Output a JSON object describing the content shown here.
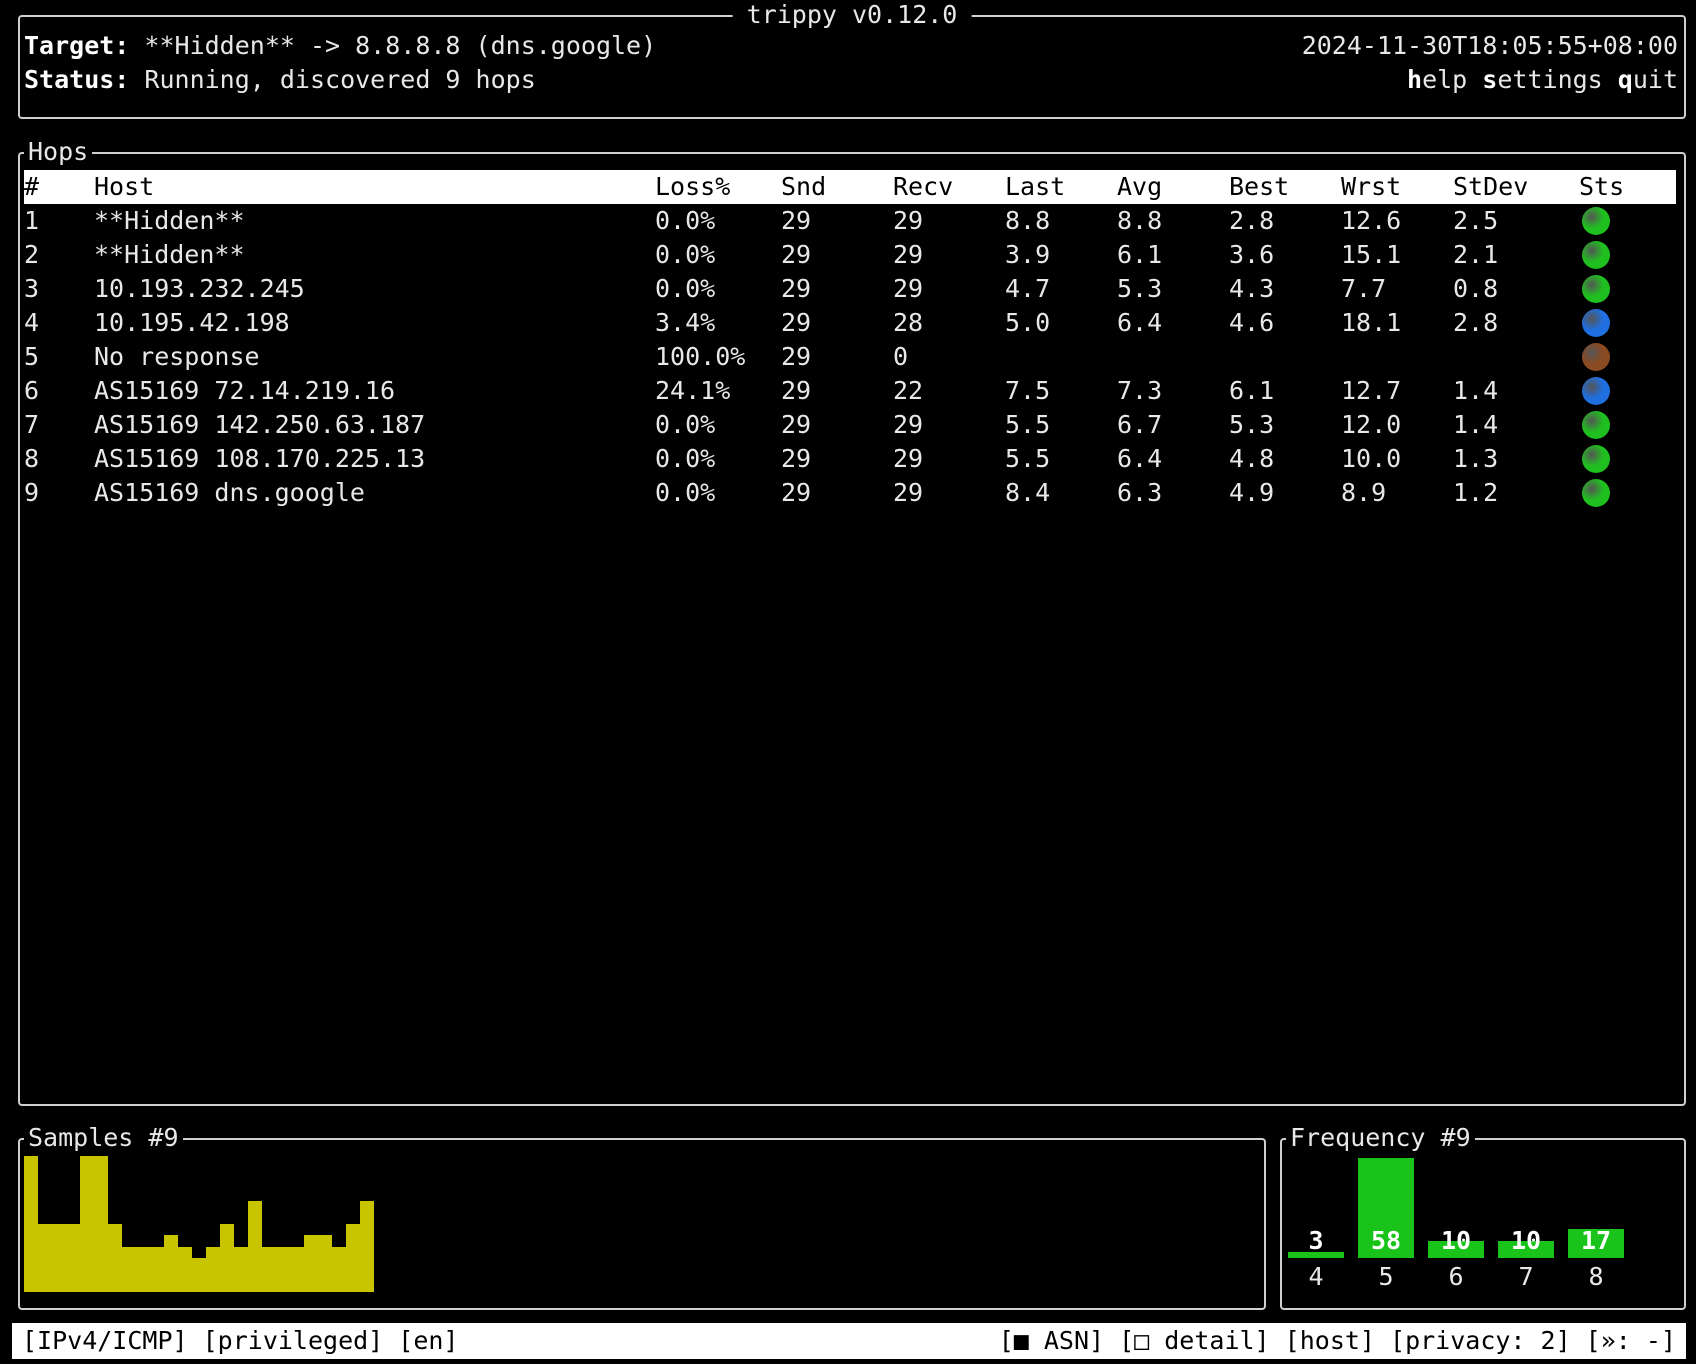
{
  "app": {
    "title": "trippy v0.12.0"
  },
  "header": {
    "target_label": "Target:",
    "target_value": " **Hidden** -> 8.8.8.8 (dns.google)",
    "status_label": "Status:",
    "status_value": " Running, discovered 9 hops",
    "timestamp": "2024-11-30T18:05:55+08:00",
    "menu": [
      {
        "key": "h",
        "rest": "elp"
      },
      {
        "key": "s",
        "rest": "ettings"
      },
      {
        "key": "q",
        "rest": "uit"
      }
    ]
  },
  "hops": {
    "title": "Hops",
    "columns": [
      "#",
      "Host",
      "Loss%",
      "Snd",
      "Recv",
      "Last",
      "Avg",
      "Best",
      "Wrst",
      "StDev",
      "Sts"
    ],
    "rows": [
      {
        "n": "1",
        "host": "**Hidden**",
        "loss": "0.0%",
        "snd": "29",
        "recv": "29",
        "last": "8.8",
        "avg": "8.8",
        "best": "2.8",
        "wrst": "12.6",
        "stdev": "2.5",
        "sts": "#1fbf1f"
      },
      {
        "n": "2",
        "host": "**Hidden**",
        "loss": "0.0%",
        "snd": "29",
        "recv": "29",
        "last": "3.9",
        "avg": "6.1",
        "best": "3.6",
        "wrst": "15.1",
        "stdev": "2.1",
        "sts": "#1fbf1f"
      },
      {
        "n": "3",
        "host": "10.193.232.245",
        "loss": "0.0%",
        "snd": "29",
        "recv": "29",
        "last": "4.7",
        "avg": "5.3",
        "best": "4.3",
        "wrst": "7.7",
        "stdev": "0.8",
        "sts": "#1fbf1f"
      },
      {
        "n": "4",
        "host": "10.195.42.198",
        "loss": "3.4%",
        "snd": "29",
        "recv": "28",
        "last": "5.0",
        "avg": "6.4",
        "best": "4.6",
        "wrst": "18.1",
        "stdev": "2.8",
        "sts": "#1f6fe0"
      },
      {
        "n": "5",
        "host": "No response",
        "loss": "100.0%",
        "snd": "29",
        "recv": "0",
        "last": "",
        "avg": "",
        "best": "",
        "wrst": "",
        "stdev": "",
        "sts": "#8a4a22"
      },
      {
        "n": "6",
        "host": "AS15169 72.14.219.16",
        "loss": "24.1%",
        "snd": "29",
        "recv": "22",
        "last": "7.5",
        "avg": "7.3",
        "best": "6.1",
        "wrst": "12.7",
        "stdev": "1.4",
        "sts": "#1f6fe0"
      },
      {
        "n": "7",
        "host": "AS15169 142.250.63.187",
        "loss": "0.0%",
        "snd": "29",
        "recv": "29",
        "last": "5.5",
        "avg": "6.7",
        "best": "5.3",
        "wrst": "12.0",
        "stdev": "1.4",
        "sts": "#1fbf1f"
      },
      {
        "n": "8",
        "host": "AS15169 108.170.225.13",
        "loss": "0.0%",
        "snd": "29",
        "recv": "29",
        "last": "5.5",
        "avg": "6.4",
        "best": "4.8",
        "wrst": "10.0",
        "stdev": "1.3",
        "sts": "#1fbf1f"
      },
      {
        "n": "9",
        "host": "AS15169 dns.google",
        "loss": "0.0%",
        "snd": "29",
        "recv": "29",
        "last": "8.4",
        "avg": "6.3",
        "best": "4.9",
        "wrst": "8.9",
        "stdev": "1.2",
        "sts": "#1fbf1f"
      }
    ]
  },
  "samples": {
    "title": "Samples #9",
    "color": "#c8c400",
    "values": [
      6,
      3,
      3,
      3,
      6,
      6,
      3,
      2,
      2,
      2,
      2.5,
      2,
      1.5,
      2,
      3,
      2,
      4,
      2,
      2,
      2,
      2.5,
      2.5,
      2,
      3,
      4
    ]
  },
  "frequency": {
    "title": "Frequency #9",
    "color": "#19c319",
    "bins": [
      {
        "label": "4",
        "value": "3",
        "count": 3
      },
      {
        "label": "5",
        "value": "58",
        "count": 58
      },
      {
        "label": "6",
        "value": "10",
        "count": 10
      },
      {
        "label": "7",
        "value": "10",
        "count": 10
      },
      {
        "label": "8",
        "value": "17",
        "count": 17
      }
    ]
  },
  "footer": {
    "left": "[IPv4/ICMP] [privileged] [en]",
    "right": "[■ ASN] [□ detail] [host] [privacy: 2] [»: -]"
  }
}
